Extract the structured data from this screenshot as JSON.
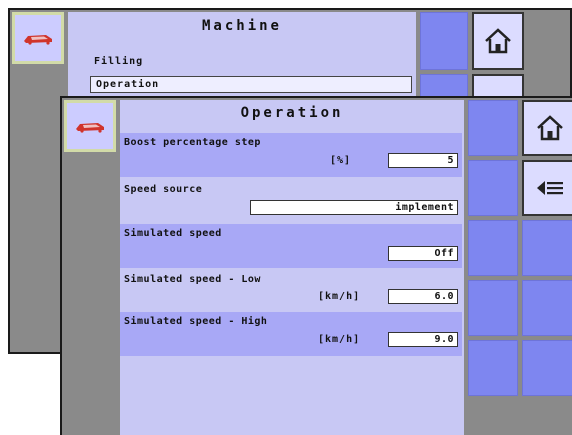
{
  "back_screen": {
    "title": "Machine",
    "items": [
      {
        "label": "Filling"
      },
      {
        "label": "Operation"
      }
    ],
    "softkeys": [
      {
        "icon": "home-icon"
      },
      {
        "icon": "back-arrow-icon"
      }
    ]
  },
  "front_screen": {
    "title": "Operation",
    "settings": [
      {
        "label": "Boost percentage step",
        "unit": "[%]",
        "value": "5"
      },
      {
        "label": "Speed source",
        "unit": "",
        "value": "implement"
      },
      {
        "label": "Simulated speed",
        "unit": "",
        "value": "Off"
      },
      {
        "label": "Simulated speed - Low",
        "unit": "[km/h]",
        "value": "6.0"
      },
      {
        "label": "Simulated speed - High",
        "unit": "[km/h]",
        "value": "9.0"
      }
    ],
    "softkeys": [
      {
        "icon": "home-icon"
      },
      {
        "icon": "back-arrow-icon"
      }
    ]
  },
  "colors": {
    "panel": "#c8c8f4",
    "row_shade": "#a8a8f6",
    "softkey": "#7e86f0",
    "bezel": "#8a8a8a",
    "logo_red": "#d0342c",
    "logo_border": "#d2dba8"
  }
}
